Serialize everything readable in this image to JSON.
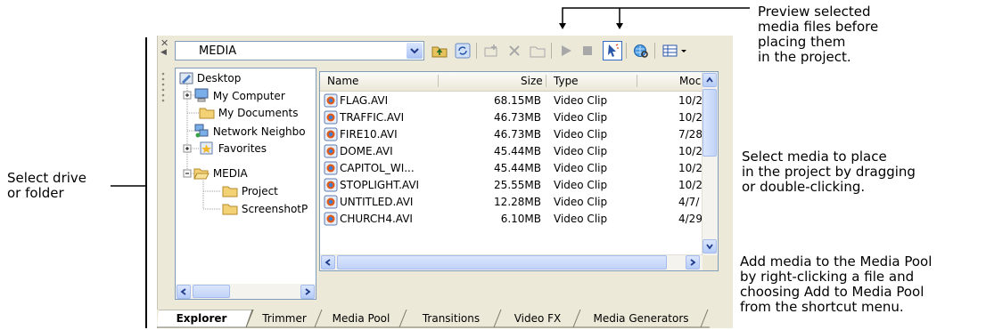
{
  "callouts": {
    "preview": "Preview selected\nmedia files before\nplacing them\nin the project.",
    "select_media": "Select media to place\nin the project by dragging\nor double-clicking.",
    "add_media": "Add media to the Media Pool\nby right-clicking a file and\nchoosing Add to Media Pool\nfrom the shortcut menu.",
    "select_drive": "Select drive\nor folder"
  },
  "toolbar": {
    "path": "MEDIA",
    "buttons": [
      "up-folder-icon",
      "refresh-icon",
      "add-to-media-pool-icon",
      "delete-icon",
      "new-folder-icon",
      "play-icon",
      "stop-icon",
      "auto-preview-icon",
      "web-icon",
      "views-icon"
    ]
  },
  "tree": {
    "items": [
      {
        "label": "Desktop",
        "icon": "desktop-icon"
      },
      {
        "label": "My Computer",
        "icon": "computer-icon"
      },
      {
        "label": "My Documents",
        "icon": "folder-icon"
      },
      {
        "label": "Network Neighbo",
        "icon": "network-icon"
      },
      {
        "label": "Favorites",
        "icon": "favorites-icon"
      },
      {
        "label": "MEDIA",
        "icon": "folder-open-icon"
      },
      {
        "label": "Project",
        "icon": "folder-icon"
      },
      {
        "label": "ScreenshotP",
        "icon": "folder-icon"
      }
    ]
  },
  "list": {
    "columns": [
      "Name",
      "Size",
      "Type",
      "Moc"
    ],
    "rows": [
      {
        "name": "FLAG.AVI",
        "size": "68.15MB",
        "type": "Video Clip",
        "mod": "10/2"
      },
      {
        "name": "TRAFFIC.AVI",
        "size": "46.73MB",
        "type": "Video Clip",
        "mod": "10/2"
      },
      {
        "name": "FIRE10.AVI",
        "size": "46.73MB",
        "type": "Video Clip",
        "mod": "7/28"
      },
      {
        "name": "DOME.AVI",
        "size": "45.44MB",
        "type": "Video Clip",
        "mod": "10/2"
      },
      {
        "name": "CAPITOL_WI...",
        "size": "45.44MB",
        "type": "Video Clip",
        "mod": "10/2"
      },
      {
        "name": "STOPLIGHT.AVI",
        "size": "25.55MB",
        "type": "Video Clip",
        "mod": "10/2"
      },
      {
        "name": "UNTITLED.AVI",
        "size": "12.28MB",
        "type": "Video Clip",
        "mod": "4/7/"
      },
      {
        "name": "CHURCH4.AVI",
        "size": "6.10MB",
        "type": "Video Clip",
        "mod": "4/29"
      }
    ]
  },
  "tabs": [
    "Explorer",
    "Trimmer",
    "Media Pool",
    "Transitions",
    "Video FX",
    "Media Generators"
  ]
}
